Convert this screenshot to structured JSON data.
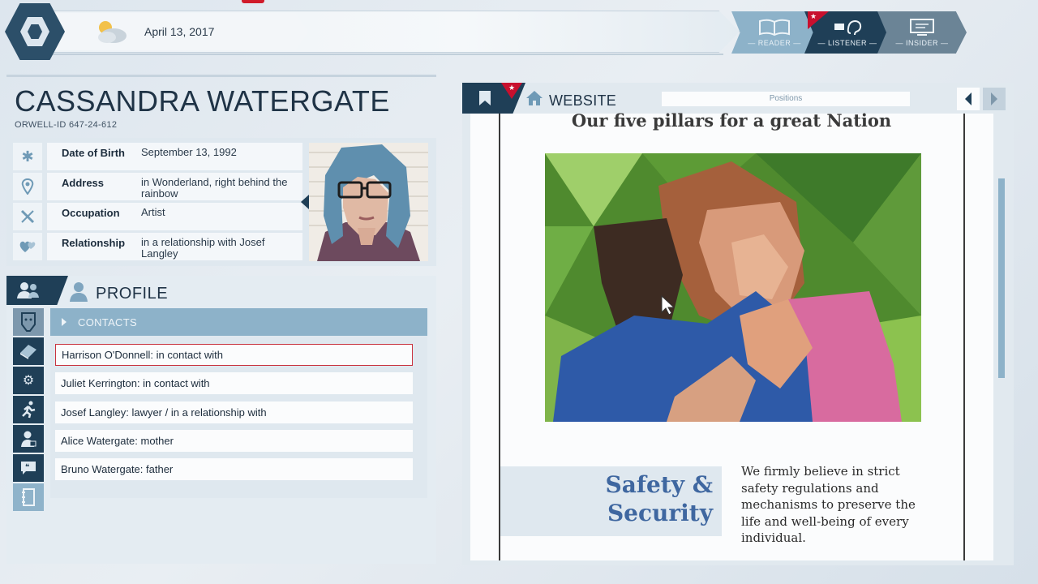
{
  "header": {
    "date": "April 13, 2017",
    "modes": [
      {
        "label": "— READER —",
        "icon": "book-icon"
      },
      {
        "label": "— LISTENER —",
        "icon": "ear-icon"
      },
      {
        "label": "— INSIDER —",
        "icon": "monitor-icon"
      }
    ],
    "badge_symbol": "★"
  },
  "person": {
    "name": "CASSANDRA WATERGATE",
    "orwell_id": "ORWELL-ID  647-24-612",
    "fields": [
      {
        "key": "Date of Birth",
        "value": "September 13, 1992",
        "icon": "asterisk-icon"
      },
      {
        "key": "Address",
        "value": "in Wonderland, right behind the rainbow",
        "icon": "location-pin-icon"
      },
      {
        "key": "Occupation",
        "value": "Artist",
        "icon": "tools-icon"
      },
      {
        "key": "Relationship",
        "value": "in a relationship with Josef Langley",
        "icon": "hearts-icon"
      }
    ]
  },
  "profile": {
    "title": "PROFILE",
    "contacts_label": "CONTACTS",
    "contacts": [
      "Harrison O'Donnell: in contact with",
      "Juliet Kerrington: in contact with",
      "Josef Langley: lawyer / in a relationship with",
      "Alice Watergate: mother",
      "Bruno Watergate: father"
    ],
    "side_nav_icons": [
      "face-icon",
      "book-icon",
      "gears-icon",
      "runner-icon",
      "person-badge-icon",
      "speech-bubble-icon",
      "notebook-icon"
    ]
  },
  "browser": {
    "tab_label": "WEBSITE",
    "url": "Positions",
    "page_heading": "Our five pillars for a great Nation",
    "section_title": "Safety & Security",
    "section_body": "We firmly believe in strict safety regulations and mechanisms to preserve the life and well-being of every individual."
  },
  "colors": {
    "dark_navy": "#1f3f57",
    "accent_blue": "#8db2c9",
    "alert_red": "#c8102e",
    "heading_blue": "#3f67a0"
  }
}
